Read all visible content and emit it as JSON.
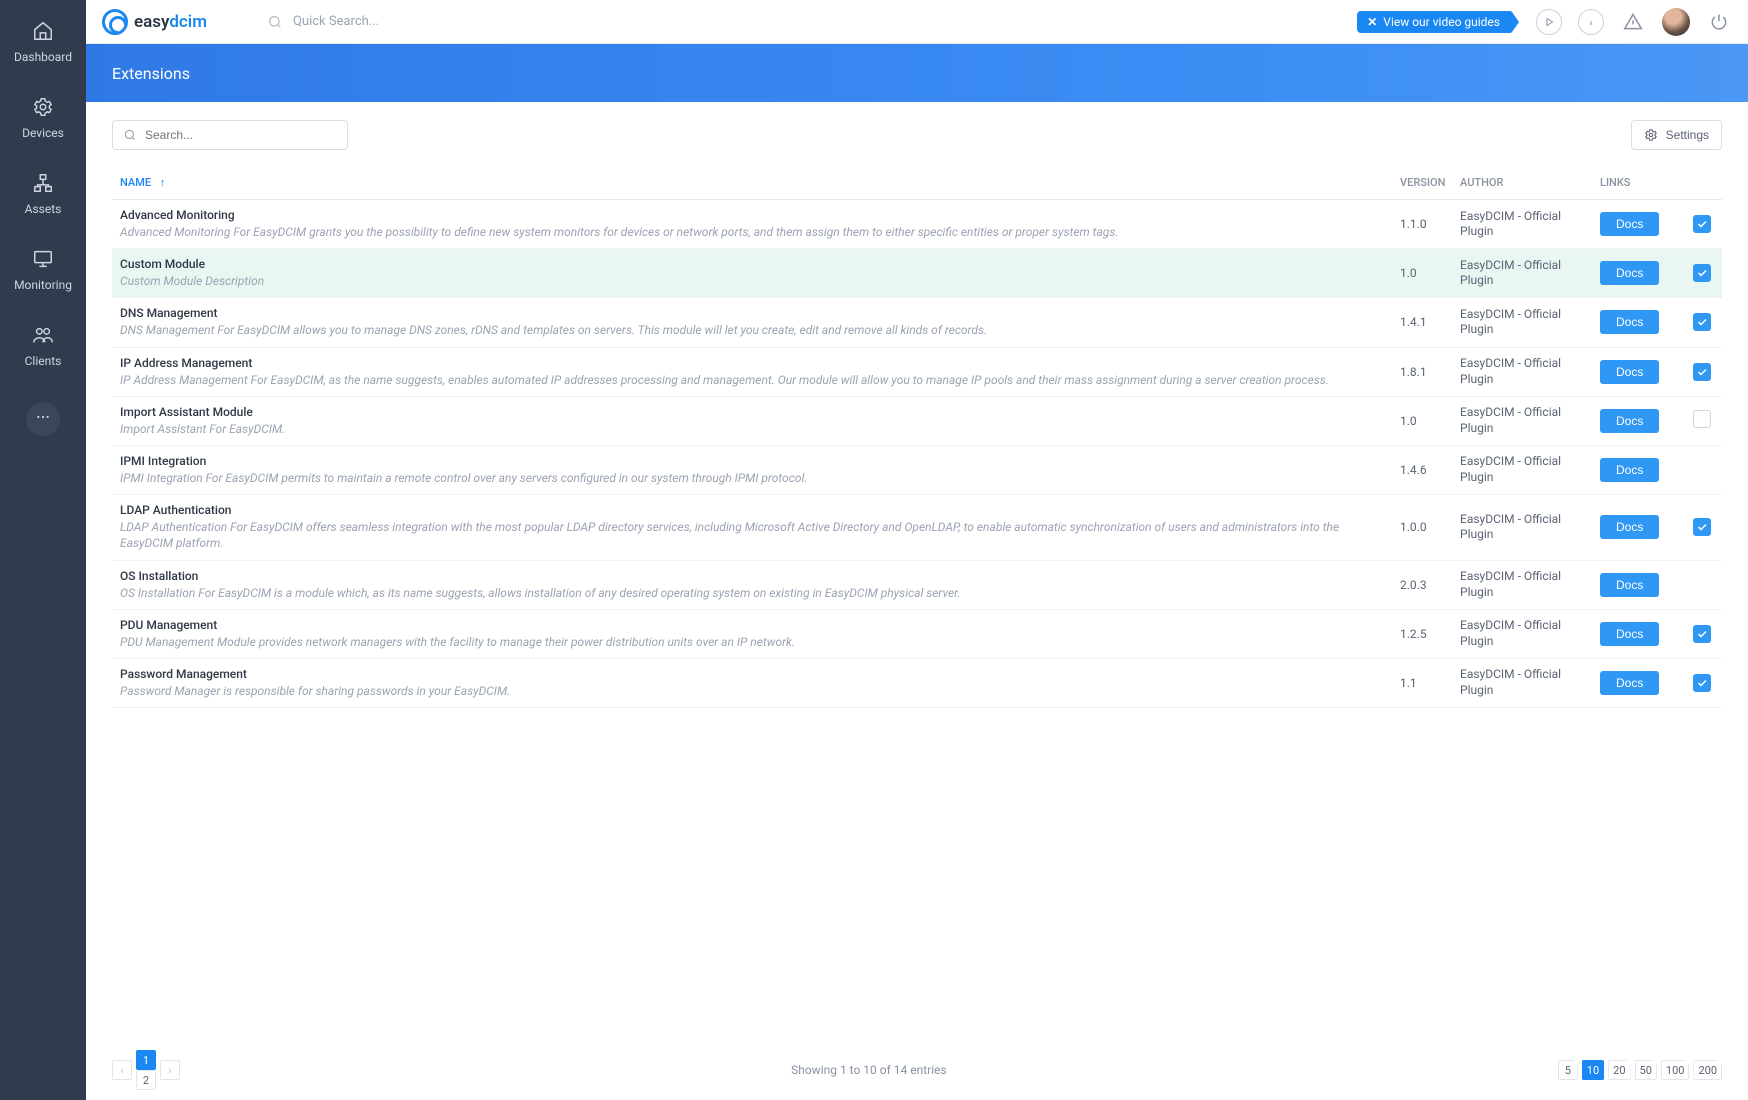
{
  "brand": {
    "text_a": "easy",
    "text_b": "dcim"
  },
  "topbar": {
    "quick_search_placeholder": "Quick Search...",
    "guides_label": "View our video guides"
  },
  "sidebar": {
    "items": [
      {
        "label": "Dashboard"
      },
      {
        "label": "Devices"
      },
      {
        "label": "Assets"
      },
      {
        "label": "Monitoring"
      },
      {
        "label": "Clients"
      }
    ]
  },
  "page": {
    "title": "Extensions",
    "search_placeholder": "Search...",
    "settings_label": "Settings"
  },
  "table": {
    "headers": {
      "name": "NAME",
      "version": "VERSION",
      "author": "AUTHOR",
      "links": "LINKS"
    },
    "sort_by": "name_asc",
    "author_default": "EasyDCIM - Official Plugin",
    "docs_label": "Docs",
    "rows": [
      {
        "name": "Advanced Monitoring",
        "desc": "Advanced Monitoring For EasyDCIM grants you the possibility to define new system monitors for devices or network ports, and them assign them to either specific entities or proper system tags.",
        "version": "1.1.0",
        "author": "EasyDCIM - Official Plugin",
        "enabled": true,
        "highlight": false
      },
      {
        "name": "Custom Module",
        "desc": "Custom Module Description",
        "version": "1.0",
        "author": "EasyDCIM - Official Plugin",
        "enabled": true,
        "highlight": true
      },
      {
        "name": "DNS Management",
        "desc": "DNS Management For EasyDCIM allows you to manage DNS zones, rDNS and templates on servers. This module will let you create, edit and remove all kinds of records.",
        "version": "1.4.1",
        "author": "EasyDCIM - Official Plugin",
        "enabled": true,
        "highlight": false
      },
      {
        "name": "IP Address Management",
        "desc": "IP Address Management For EasyDCIM, as the name suggests, enables automated IP addresses processing and management. Our module will allow you to manage IP pools and their mass assignment during a server creation process.",
        "version": "1.8.1",
        "author": "EasyDCIM - Official Plugin",
        "enabled": true,
        "highlight": false
      },
      {
        "name": "Import Assistant Module",
        "desc": "Import Assistant For EasyDCIM.",
        "version": "1.0",
        "author": "EasyDCIM - Official Plugin",
        "enabled": false,
        "highlight": false
      },
      {
        "name": "IPMI Integration",
        "desc": "IPMI Integration For EasyDCIM permits to maintain a remote control over any servers configured in our system through IPMI protocol.",
        "version": "1.4.6",
        "author": "EasyDCIM - Official Plugin",
        "enabled": null,
        "highlight": false
      },
      {
        "name": "LDAP Authentication",
        "desc": "LDAP Authentication For EasyDCIM offers seamless integration with the most popular LDAP directory services, including Microsoft Active Directory and OpenLDAP, to enable automatic synchronization of users and administrators into the EasyDCIM platform.",
        "version": "1.0.0",
        "author": "EasyDCIM - Official Plugin",
        "enabled": true,
        "highlight": false
      },
      {
        "name": "OS Installation",
        "desc": "OS Installation For EasyDCIM is a module which, as its name suggests, allows installation of any desired operating system on existing in EasyDCIM physical server.",
        "version": "2.0.3",
        "author": "EasyDCIM - Official Plugin",
        "enabled": null,
        "highlight": false
      },
      {
        "name": "PDU Management",
        "desc": "PDU Management Module provides network managers with the facility to manage their power distribution units over an IP network.",
        "version": "1.2.5",
        "author": "EasyDCIM - Official Plugin",
        "enabled": true,
        "highlight": false
      },
      {
        "name": "Password Management",
        "desc": "Password Manager is responsible for sharing passwords in your EasyDCIM.",
        "version": "1.1",
        "author": "EasyDCIM - Official Plugin",
        "enabled": true,
        "highlight": false
      }
    ]
  },
  "footer": {
    "showing_text": "Showing 1 to 10 of 14 entries",
    "pages": [
      "1",
      "2"
    ],
    "active_page": "1",
    "page_sizes": [
      "5",
      "10",
      "20",
      "50",
      "100",
      "200"
    ],
    "active_size": "10"
  }
}
